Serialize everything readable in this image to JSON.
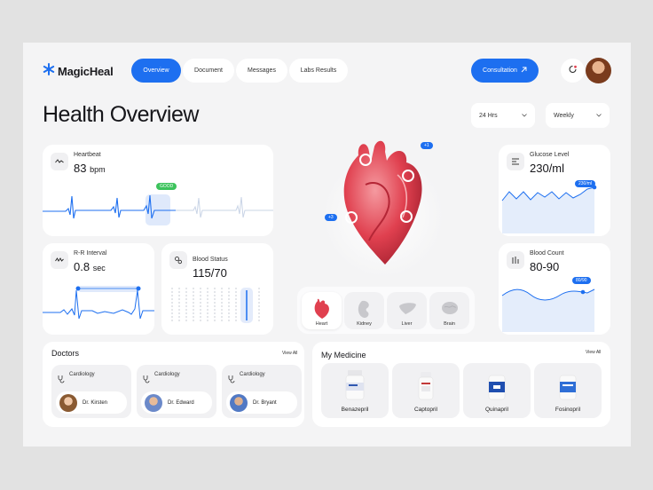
{
  "brand": {
    "name": "MagicHeal"
  },
  "nav": {
    "tabs": [
      {
        "label": "Overview",
        "active": true
      },
      {
        "label": "Document"
      },
      {
        "label": "Messages"
      },
      {
        "label": "Labs Results"
      }
    ]
  },
  "header": {
    "consultation_label": "Consultation"
  },
  "page": {
    "title": "Health Overview"
  },
  "filters": {
    "range": "24 Hrs",
    "period": "Weekly"
  },
  "heartbeat": {
    "label": "Heartbeat",
    "value": "83",
    "unit": "bpm",
    "badge": "GOOD"
  },
  "rr": {
    "label": "R-R Interval",
    "value": "0.8",
    "unit": "sec"
  },
  "blood_status": {
    "label": "Blood Status",
    "value": "115/70"
  },
  "glucose": {
    "label": "Glucose Level",
    "value": "230/ml",
    "badge": "230/ml"
  },
  "blood_count": {
    "label": "Blood Count",
    "value": "80-90",
    "badge": "80/90"
  },
  "heart_model": {
    "badge_top": "+1",
    "badge_left": "+3"
  },
  "organs": [
    "Heart",
    "Kidney",
    "Liver",
    "Brain"
  ],
  "doctors": {
    "title": "Doctors",
    "view_all": "View All",
    "items": [
      {
        "specialty": "Cardiology",
        "name": "Dr. Kirsten"
      },
      {
        "specialty": "Cardiology",
        "name": "Dr. Edward"
      },
      {
        "specialty": "Cardiology",
        "name": "Dr. Bryant"
      }
    ]
  },
  "medicine": {
    "title": "My Medicine",
    "view_all": "View All",
    "items": [
      "Benazepril",
      "Captopril",
      "Quinapril",
      "Fosinopril"
    ]
  },
  "colors": {
    "accent": "#1d6ff0",
    "good": "#3cc35c",
    "background": "#f4f4f5",
    "heart": "#e0404f"
  }
}
